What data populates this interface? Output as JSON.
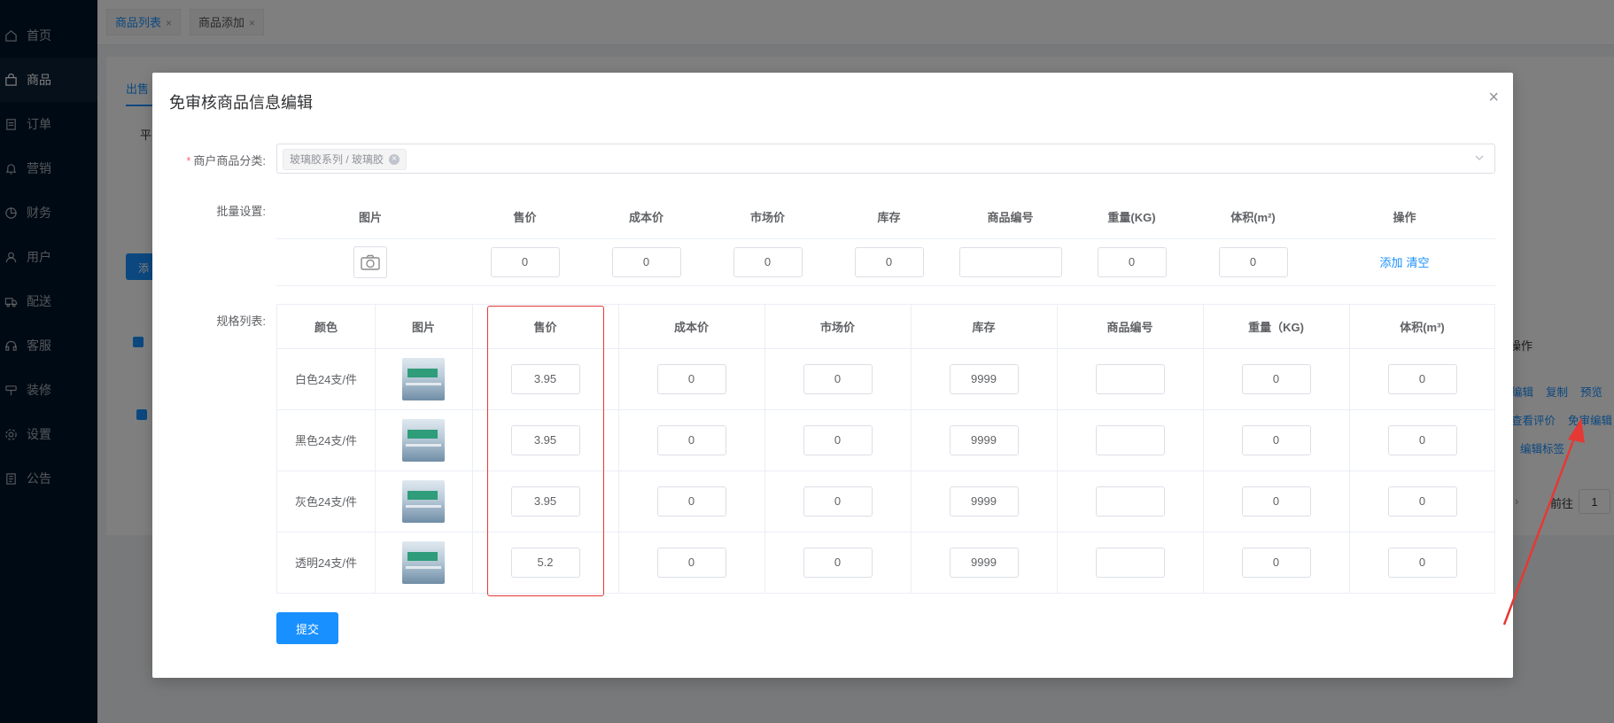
{
  "sidebar": {
    "items": [
      {
        "label": "首页",
        "icon": "home-icon"
      },
      {
        "label": "商品",
        "icon": "bag-icon"
      },
      {
        "label": "订单",
        "icon": "document-icon"
      },
      {
        "label": "营销",
        "icon": "bell-icon"
      },
      {
        "label": "财务",
        "icon": "pie-chart-icon"
      },
      {
        "label": "用户",
        "icon": "user-icon"
      },
      {
        "label": "配送",
        "icon": "truck-icon"
      },
      {
        "label": "客服",
        "icon": "headset-icon"
      },
      {
        "label": "装修",
        "icon": "brush-icon"
      },
      {
        "label": "设置",
        "icon": "gear-icon"
      },
      {
        "label": "公告",
        "icon": "notice-icon"
      }
    ],
    "active_index": 1
  },
  "tabs": [
    {
      "label": "商品列表",
      "active": true
    },
    {
      "label": "商品添加",
      "active": false
    }
  ],
  "background": {
    "tab_fragment": "出售",
    "filter_fragment": "平",
    "add_fragment": "添",
    "operation_header": "操作",
    "row_actions": [
      "编辑",
      "复制",
      "预览",
      "查看评价",
      "免审编辑",
      "编辑标签"
    ],
    "goto_label": "前往",
    "page_number": "1",
    "next_arrow": "›"
  },
  "modal": {
    "title": "免审核商品信息编辑",
    "close": "×",
    "category_label": "商户商品分类:",
    "category_required_mark": "*",
    "category_tag": "玻璃胶系列 / 玻璃胶",
    "batch_label": "批量设置:",
    "batch_headers": [
      "图片",
      "售价",
      "成本价",
      "市场价",
      "库存",
      "商品编号",
      "重量(KG)",
      "体积(m²)",
      "操作"
    ],
    "batch_values": {
      "price": "0",
      "cost": "0",
      "market": "0",
      "stock": "0",
      "sku": "",
      "weight": "0",
      "volume": "0"
    },
    "batch_actions": {
      "add": "添加",
      "clear": "清空"
    },
    "spec_label": "规格列表:",
    "spec_headers": [
      "颜色",
      "图片",
      "售价",
      "成本价",
      "市场价",
      "库存",
      "商品编号",
      "重量（KG)",
      "体积(m³)"
    ],
    "spec_rows": [
      {
        "color": "白色24支/件",
        "price": "3.95",
        "cost": "0",
        "market": "0",
        "stock": "9999",
        "sku": "",
        "weight": "0",
        "volume": "0"
      },
      {
        "color": "黑色24支/件",
        "price": "3.95",
        "cost": "0",
        "market": "0",
        "stock": "9999",
        "sku": "",
        "weight": "0",
        "volume": "0"
      },
      {
        "color": "灰色24支/件",
        "price": "3.95",
        "cost": "0",
        "market": "0",
        "stock": "9999",
        "sku": "",
        "weight": "0",
        "volume": "0"
      },
      {
        "color": "透明24支/件",
        "price": "5.2",
        "cost": "0",
        "market": "0",
        "stock": "9999",
        "sku": "",
        "weight": "0",
        "volume": "0"
      }
    ],
    "submit_label": "提交"
  },
  "colors": {
    "primary": "#1890ff",
    "highlight": "#e53935",
    "sidebar": "#001529"
  }
}
